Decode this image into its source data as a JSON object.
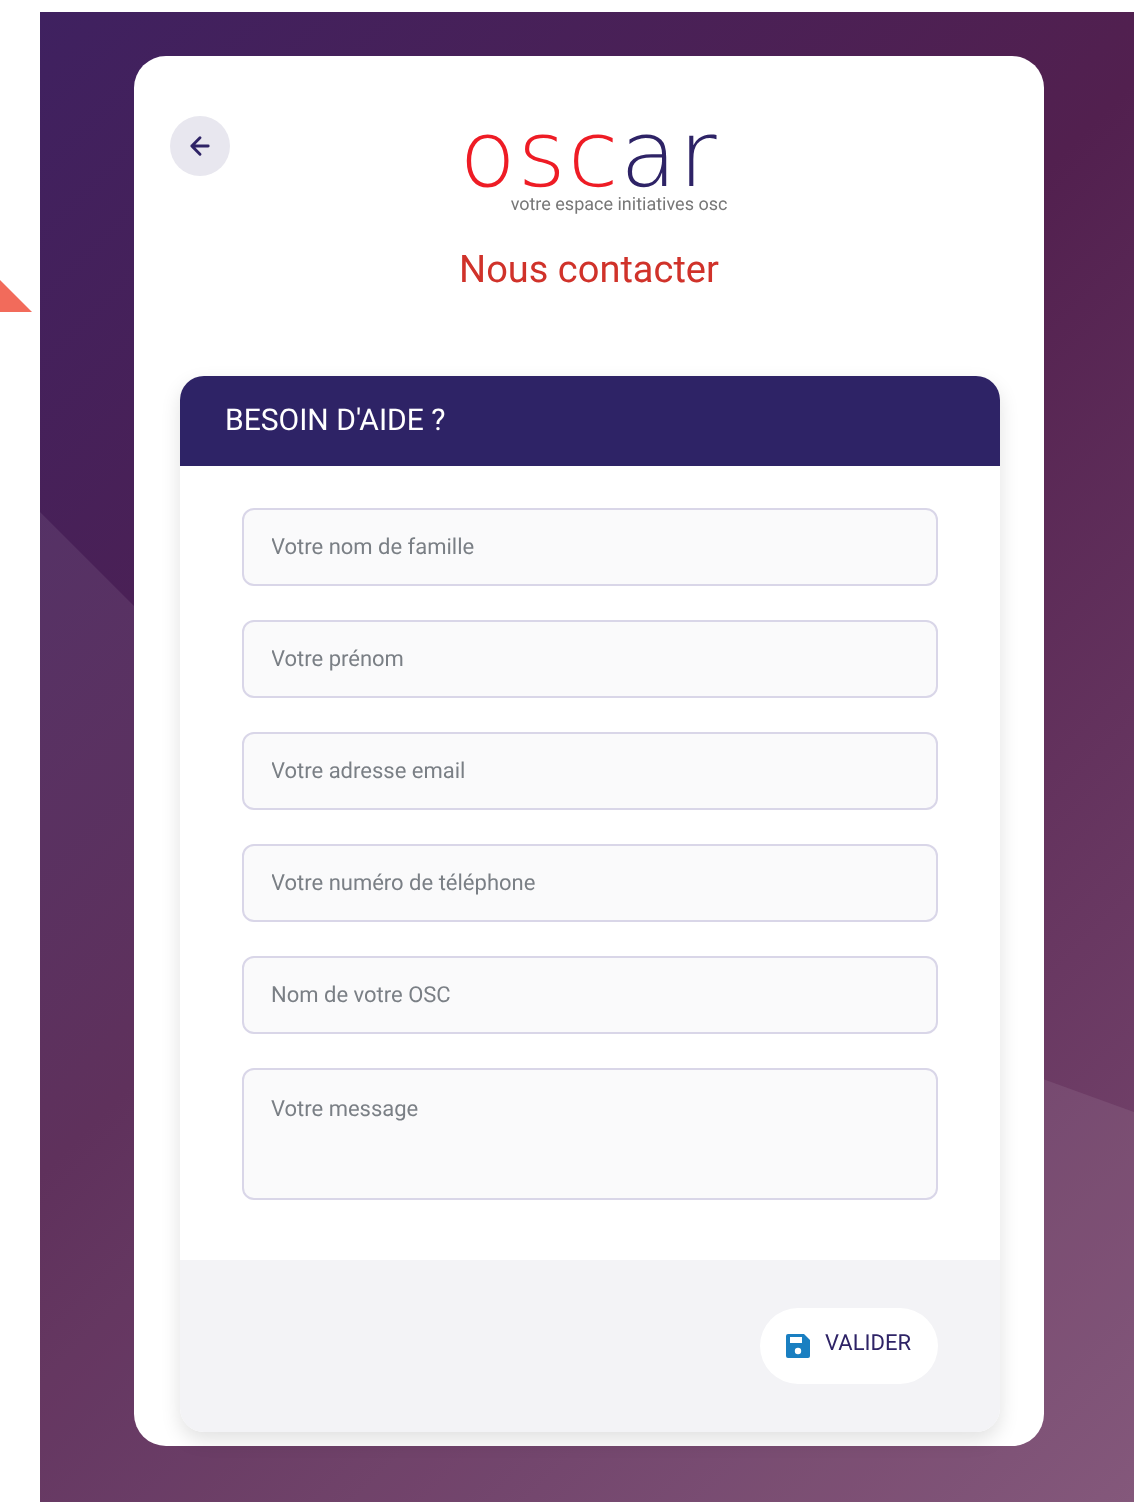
{
  "logo": {
    "segments": [
      {
        "text": "osc",
        "color": "#ee1c25"
      },
      {
        "text": "ar",
        "color": "#2e2366"
      }
    ],
    "tagline": "votre espace initiatives osc"
  },
  "title": "Nous contacter",
  "panel": {
    "heading": "BESOIN D'AIDE ?",
    "fields": [
      {
        "kind": "input",
        "placeholder": "Votre nom de famille"
      },
      {
        "kind": "input",
        "placeholder": "Votre prénom"
      },
      {
        "kind": "input",
        "placeholder": "Votre adresse email"
      },
      {
        "kind": "input",
        "placeholder": "Votre numéro de téléphone"
      },
      {
        "kind": "input",
        "placeholder": "Nom de votre OSC"
      },
      {
        "kind": "textarea",
        "placeholder": "Votre message"
      }
    ],
    "submit": "VALIDER"
  }
}
